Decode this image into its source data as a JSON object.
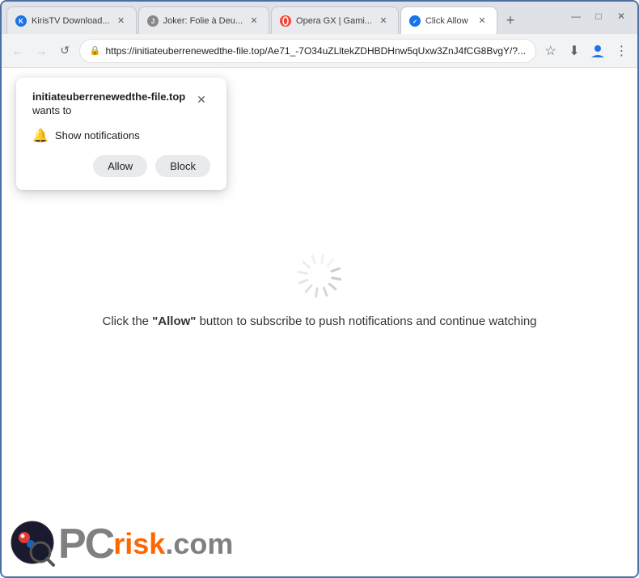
{
  "window": {
    "title": "Click Allow"
  },
  "tabs": [
    {
      "id": "tab1",
      "label": "KirisTV Download...",
      "favicon_color": "#1a73e8",
      "active": false
    },
    {
      "id": "tab2",
      "label": "Joker: Folie à Deu...",
      "favicon_color": "#9c27b0",
      "active": false
    },
    {
      "id": "tab3",
      "label": "Opera GX | Gami...",
      "favicon_color": "#f44336",
      "active": false
    },
    {
      "id": "tab4",
      "label": "Click Allow",
      "favicon_color": "#1a73e8",
      "active": true
    }
  ],
  "toolbar": {
    "url": "https://initiateuberrenewedthe-file.top/Ae71_-7O34uZLltekZDHBDHnw5qUxw3ZnJ4fCG8BvgY/?..."
  },
  "popup": {
    "site_name": "initiateuberrenewedthe-file.top",
    "wants_text": "wants to",
    "permission_text": "Show notifications",
    "allow_label": "Allow",
    "block_label": "Block"
  },
  "page": {
    "message_pre": "Click the ",
    "message_bold": "\"Allow\"",
    "message_post": " button to subscribe to push notifications and continue watching"
  },
  "logo": {
    "pc_text": "PC",
    "risk_text": "risk",
    "dotcom_text": ".com"
  },
  "icons": {
    "back": "←",
    "forward": "→",
    "refresh": "↺",
    "close": "✕",
    "star": "☆",
    "download": "⬇",
    "profile": "👤",
    "more": "⋮",
    "bell": "🔔",
    "lock": "🔒",
    "minimize": "—",
    "maximize": "□",
    "win_close": "✕",
    "new_tab": "+"
  }
}
